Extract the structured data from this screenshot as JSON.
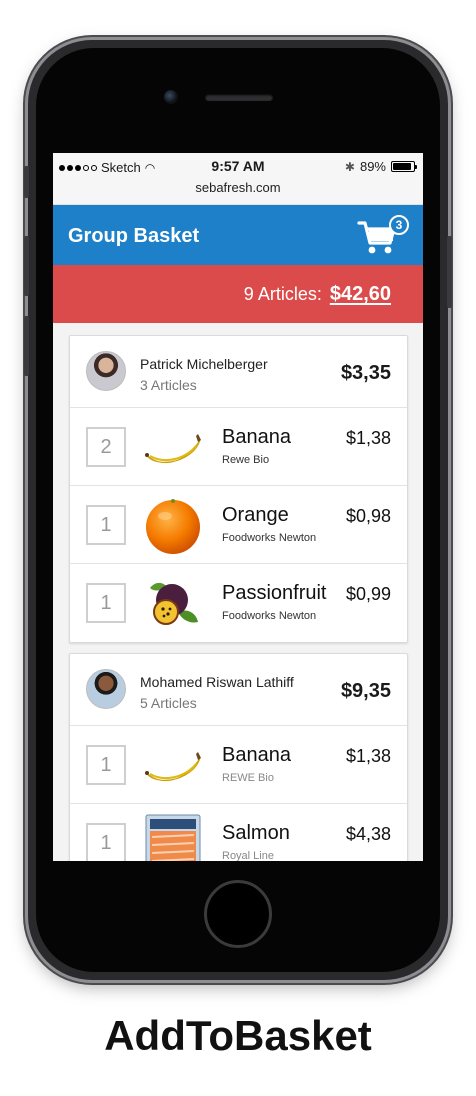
{
  "status_bar": {
    "carrier": "Sketch",
    "time": "9:57 AM",
    "battery": "89%",
    "battery_level": 0.89,
    "url": "sebafresh.com"
  },
  "app_bar": {
    "title": "Group Basket",
    "cart_count": "3"
  },
  "summary": {
    "articles": "9 Articles:",
    "total": "$42,60"
  },
  "members": [
    {
      "name": "Patrick Michelberger",
      "articles": "3 Articles",
      "total": "$3,35",
      "items": [
        {
          "qty": "2",
          "name": "Banana",
          "store": "Rewe Bio",
          "price": "$1,38",
          "icon": "banana-icon"
        },
        {
          "qty": "1",
          "name": "Orange",
          "store": "Foodworks Newton",
          "price": "$0,98",
          "icon": "orange-icon"
        },
        {
          "qty": "1",
          "name": "Passionfruit",
          "store": "Foodworks Newton",
          "price": "$0,99",
          "icon": "passionfruit-icon"
        }
      ]
    },
    {
      "name": "Mohamed Riswan Lathiff",
      "articles": "5 Articles",
      "total": "$9,35",
      "items": [
        {
          "qty": "1",
          "name": "Banana",
          "store": "REWE Bio",
          "price": "$1,38",
          "icon": "banana-icon"
        },
        {
          "qty": "1",
          "name": "Salmon",
          "store": "Royal Line",
          "price": "$4,38",
          "icon": "salmon-icon"
        }
      ]
    }
  ],
  "caption": "AddToBasket",
  "colors": {
    "app_bar": "#1d80c8",
    "summary_bar": "#dc4b4b"
  }
}
